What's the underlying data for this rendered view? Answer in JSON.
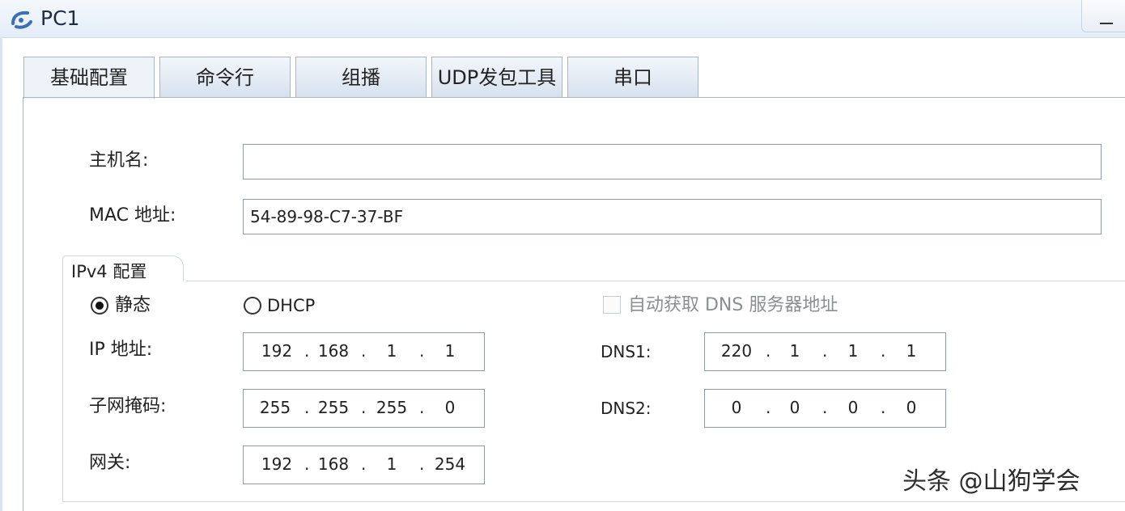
{
  "window": {
    "title": "PC1",
    "icon": "pc-app-icon",
    "minimize_icon": "minimize-icon"
  },
  "tabs": [
    {
      "label": "基础配置",
      "active": true
    },
    {
      "label": "命令行",
      "active": false
    },
    {
      "label": "组播",
      "active": false
    },
    {
      "label": "UDP发包工具",
      "active": false
    },
    {
      "label": "串口",
      "active": false
    }
  ],
  "basic": {
    "hostname_label": "主机名:",
    "hostname_value": "",
    "mac_label": "MAC 地址:",
    "mac_value": "54-89-98-C7-37-BF"
  },
  "ipv4": {
    "group_title": "IPv4 配置",
    "static_label": "静态",
    "static_selected": true,
    "dhcp_label": "DHCP",
    "dhcp_selected": false,
    "auto_dns_label": "自动获取 DNS 服务器地址",
    "auto_dns_checked": false,
    "ip_label": "IP 地址:",
    "ip": [
      "192",
      "168",
      "1",
      "1"
    ],
    "mask_label": "子网掩码:",
    "mask": [
      "255",
      "255",
      "255",
      "0"
    ],
    "gateway_label": "网关:",
    "gateway": [
      "192",
      "168",
      "1",
      "254"
    ],
    "dns1_label": "DNS1:",
    "dns1": [
      "220",
      "1",
      "1",
      "1"
    ],
    "dns2_label": "DNS2:",
    "dns2": [
      "0",
      "0",
      "0",
      "0"
    ]
  },
  "watermark": "头条 @山狗学会",
  "colors": {
    "titlebar": "#e3edf8",
    "tab_border": "#a9b6c3",
    "group_border": "#cfd7df"
  }
}
